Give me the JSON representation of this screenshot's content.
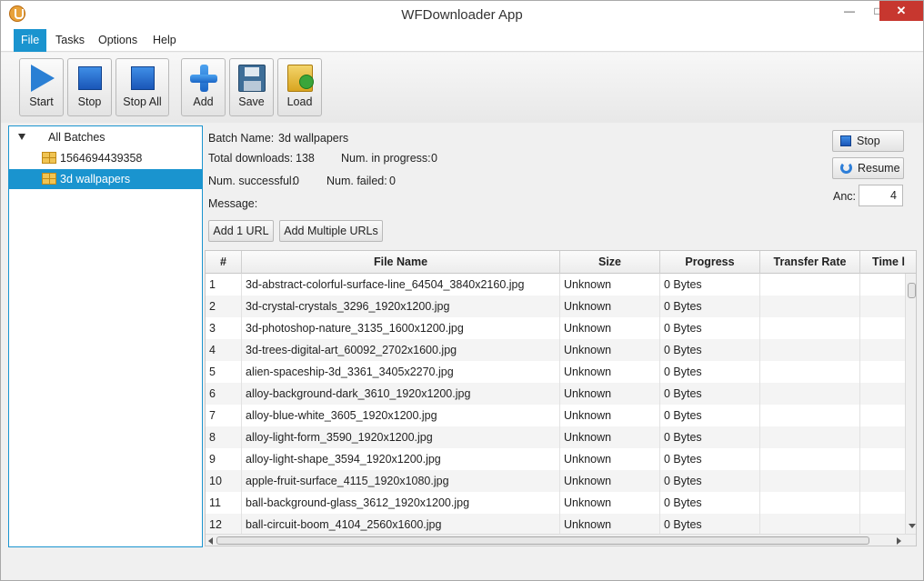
{
  "window": {
    "title": "WFDownloader App"
  },
  "menu": {
    "file": "File",
    "tasks": "Tasks",
    "options": "Options",
    "help": "Help"
  },
  "toolbar": {
    "start": "Start",
    "stop": "Stop",
    "stop_all": "Stop All",
    "add": "Add",
    "save": "Save",
    "load": "Load"
  },
  "tree": {
    "root": "All Batches",
    "items": [
      {
        "label": "1564694439358"
      },
      {
        "label": "3d wallpapers"
      }
    ]
  },
  "batch": {
    "name_label": "Batch Name:",
    "name_value": "3d wallpapers",
    "total_label": "Total downloads:",
    "total_value": "138",
    "inprog_label": "Num. in progress:",
    "inprog_value": "0",
    "success_label": "Num. successful:",
    "success_value": "0",
    "failed_label": "Num. failed:",
    "failed_value": "0",
    "message_label": "Message:",
    "add_one": "Add 1 URL",
    "add_multi": "Add Multiple URLs",
    "stop": "Stop",
    "resume": "Resume",
    "anc_label": "Anc:",
    "anc_value": "4"
  },
  "table": {
    "columns": [
      "#",
      "File Name",
      "Size",
      "Progress",
      "Transfer Rate",
      "Time l"
    ],
    "rows": [
      {
        "num": "1",
        "file": "3d-abstract-colorful-surface-line_64504_3840x2160.jpg",
        "size": "Unknown",
        "progress": "0 Bytes"
      },
      {
        "num": "2",
        "file": "3d-crystal-crystals_3296_1920x1200.jpg",
        "size": "Unknown",
        "progress": "0 Bytes"
      },
      {
        "num": "3",
        "file": "3d-photoshop-nature_3135_1600x1200.jpg",
        "size": "Unknown",
        "progress": "0 Bytes"
      },
      {
        "num": "4",
        "file": "3d-trees-digital-art_60092_2702x1600.jpg",
        "size": "Unknown",
        "progress": "0 Bytes"
      },
      {
        "num": "5",
        "file": "alien-spaceship-3d_3361_3405x2270.jpg",
        "size": "Unknown",
        "progress": "0 Bytes"
      },
      {
        "num": "6",
        "file": "alloy-background-dark_3610_1920x1200.jpg",
        "size": "Unknown",
        "progress": "0 Bytes"
      },
      {
        "num": "7",
        "file": "alloy-blue-white_3605_1920x1200.jpg",
        "size": "Unknown",
        "progress": "0 Bytes"
      },
      {
        "num": "8",
        "file": "alloy-light-form_3590_1920x1200.jpg",
        "size": "Unknown",
        "progress": "0 Bytes"
      },
      {
        "num": "9",
        "file": "alloy-light-shape_3594_1920x1200.jpg",
        "size": "Unknown",
        "progress": "0 Bytes"
      },
      {
        "num": "10",
        "file": "apple-fruit-surface_4115_1920x1080.jpg",
        "size": "Unknown",
        "progress": "0 Bytes"
      },
      {
        "num": "11",
        "file": "ball-background-glass_3612_1920x1200.jpg",
        "size": "Unknown",
        "progress": "0 Bytes"
      },
      {
        "num": "12",
        "file": "ball-circuit-boom_4104_2560x1600.jpg",
        "size": "Unknown",
        "progress": "0 Bytes"
      }
    ]
  }
}
